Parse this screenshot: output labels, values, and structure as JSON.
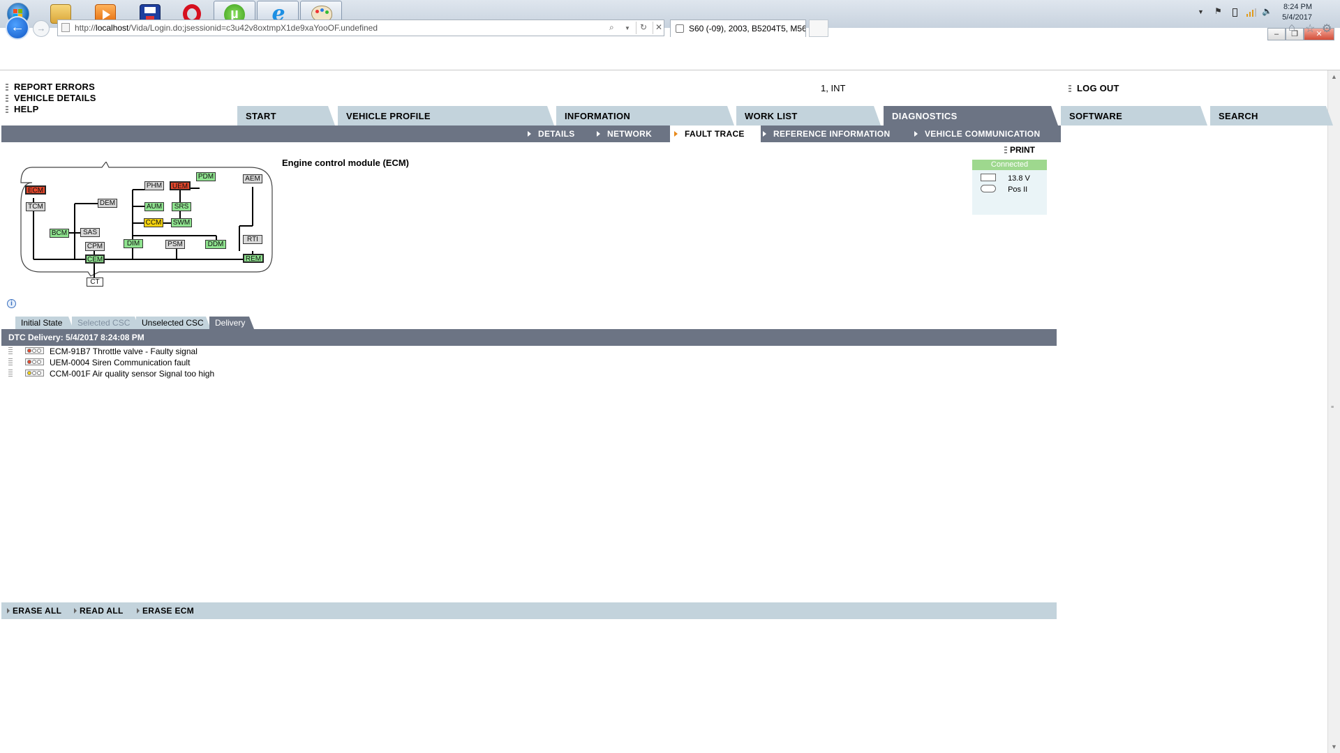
{
  "taskbar": {
    "apps": [
      "start-orb",
      "file-explorer",
      "media-player",
      "save-app",
      "opera",
      "utorrent",
      "internet-explorer",
      "paint"
    ],
    "tray": {
      "time": "8:24 PM",
      "date": "5/4/2017"
    }
  },
  "browser": {
    "url_prefix": "http://",
    "url_host": "localhost",
    "url_path": "/Vida/Login.do;jsessionid=c3u42v8oxtmpX1de9xaYooOF.undefined",
    "tab_title": "S60 (-09), 2003, B5204T5, M56,...",
    "window_controls": [
      "–",
      "❐",
      "✕"
    ]
  },
  "top_links": {
    "report_errors": "REPORT ERRORS",
    "vehicle_details": "VEHICLE DETAILS",
    "help": "HELP",
    "user": "1, INT",
    "logout": "LOG OUT"
  },
  "main_tabs": [
    "START",
    "VEHICLE PROFILE",
    "INFORMATION",
    "WORK LIST",
    "DIAGNOSTICS",
    "SOFTWARE",
    "SEARCH"
  ],
  "selected_tab": "DIAGNOSTICS",
  "sub_tabs": [
    "DETAILS",
    "NETWORK",
    "FAULT TRACE",
    "REFERENCE INFORMATION",
    "VEHICLE COMMUNICATION"
  ],
  "selected_sub_tab": "FAULT TRACE",
  "network": {
    "nodes": [
      {
        "id": "ECM",
        "state": "fault"
      },
      {
        "id": "TCM",
        "state": "grey"
      },
      {
        "id": "DEM",
        "state": "grey"
      },
      {
        "id": "BCM",
        "state": "ok"
      },
      {
        "id": "SAS",
        "state": "grey"
      },
      {
        "id": "CPM",
        "state": "grey"
      },
      {
        "id": "CEM",
        "state": "ok"
      },
      {
        "id": "CT",
        "state": "white"
      },
      {
        "id": "PHM",
        "state": "grey"
      },
      {
        "id": "UEM",
        "state": "fault"
      },
      {
        "id": "PDM",
        "state": "ok"
      },
      {
        "id": "AUM",
        "state": "ok"
      },
      {
        "id": "SRS",
        "state": "ok"
      },
      {
        "id": "CCM",
        "state": "warning"
      },
      {
        "id": "SWM",
        "state": "ok"
      },
      {
        "id": "DIM",
        "state": "ok"
      },
      {
        "id": "PSM",
        "state": "grey"
      },
      {
        "id": "DDM",
        "state": "ok"
      },
      {
        "id": "AEM",
        "state": "grey"
      },
      {
        "id": "RTI",
        "state": "grey"
      },
      {
        "id": "REM",
        "state": "ok"
      }
    ],
    "colors": {
      "ok": "#8fe38f",
      "fault": "#e4472b",
      "warning": "#f4d20f",
      "grey": "#d8d8d8"
    }
  },
  "module_title": "Engine control module (ECM)",
  "print_label": "PRINT",
  "status": {
    "connection": "Connected",
    "voltage": "13.8 V",
    "ignition": "Pos II"
  },
  "csc_tabs": [
    "Initial State",
    "Selected CSC",
    "Unselected CSC",
    "Delivery"
  ],
  "selected_csc_tab": "Delivery",
  "dtc": {
    "header": "DTC Delivery: 5/4/2017 8:24:08 PM",
    "rows": [
      {
        "text": "ECM-91B7 Throttle valve - Faulty signal",
        "light": "red"
      },
      {
        "text": "UEM-0004 Siren Communication fault",
        "light": "red"
      },
      {
        "text": "CCM-001F Air quality sensor Signal too high",
        "light": "yellow"
      }
    ]
  },
  "actions": [
    "ERASE ALL",
    "READ ALL",
    "ERASE ECM"
  ]
}
